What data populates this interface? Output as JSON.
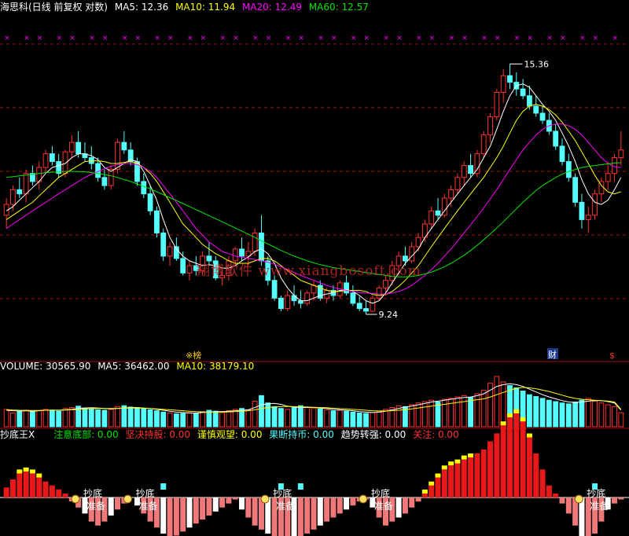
{
  "colors": {
    "up": "#ff3232",
    "down": "#54fcfc",
    "ma5": "#ffffff",
    "ma10": "#ffff00",
    "ma20": "#ff00ff",
    "ma60": "#00e600",
    "grid": "#a01010",
    "marker": "#ff00ff"
  },
  "main_header": {
    "title": "海思科(日线 前复权 对数)",
    "ma5_label": "MA5: 12.36",
    "ma10_label": "MA10: 11.94",
    "ma20_label": "MA20: 12.49",
    "ma60_label": "MA60: 12.57"
  },
  "volume_header": {
    "title": "VOLUME: 30565.90",
    "ma5_label": "MA5: 36462.00",
    "ma10_label": "MA10: 38179.10"
  },
  "indicator_header": {
    "title": "抄底王X",
    "items": [
      {
        "label": "注意底部: 0.00",
        "color": "#00e600"
      },
      {
        "label": "坚决持股: 0.00",
        "color": "#ff3232"
      },
      {
        "label": "谨慎观望: 0.00",
        "color": "#ffff00"
      },
      {
        "label": "果断持币: 0.00",
        "color": "#54fcfc"
      },
      {
        "label": "趋势转强: 0.00",
        "color": "#ffffff"
      },
      {
        "label": "关注: 0.00",
        "color": "#ff3232"
      }
    ]
  },
  "annotations": {
    "high": "15.36",
    "low": "9.24",
    "event_1": "※榜",
    "event_2": "财",
    "event_3": "$"
  },
  "indicator_labels": {
    "chao_di": "抄底",
    "zhun_bei": "准备"
  },
  "watermark": "翔博软件 www.xiangbosoft.com",
  "chart_data": {
    "type": "candlestick",
    "price_scale": "log",
    "ylim": [
      8.6,
      16.2
    ],
    "bars": [
      [
        11.3,
        11.7,
        11.0,
        11.55
      ],
      [
        11.55,
        12.0,
        11.4,
        11.9
      ],
      [
        11.9,
        12.2,
        11.7,
        11.8
      ],
      [
        11.8,
        12.4,
        11.6,
        12.3
      ],
      [
        12.3,
        12.5,
        12.0,
        12.1
      ],
      [
        12.1,
        12.6,
        11.9,
        12.45
      ],
      [
        12.45,
        12.9,
        12.3,
        12.8
      ],
      [
        12.8,
        13.0,
        12.5,
        12.6
      ],
      [
        12.6,
        12.8,
        12.2,
        12.3
      ],
      [
        12.3,
        12.9,
        12.2,
        12.85
      ],
      [
        12.85,
        13.3,
        12.7,
        13.1
      ],
      [
        13.1,
        13.4,
        12.7,
        12.8
      ],
      [
        12.8,
        13.1,
        12.6,
        12.7
      ],
      [
        12.7,
        13.0,
        12.4,
        12.55
      ],
      [
        12.55,
        12.7,
        12.1,
        12.2
      ],
      [
        12.2,
        12.4,
        11.9,
        12.0
      ],
      [
        12.0,
        12.5,
        11.9,
        12.4
      ],
      [
        12.4,
        13.2,
        12.3,
        13.1
      ],
      [
        13.1,
        13.4,
        12.8,
        12.9
      ],
      [
        12.9,
        13.1,
        12.5,
        12.6
      ],
      [
        12.6,
        12.7,
        12.0,
        12.1
      ],
      [
        12.1,
        12.3,
        11.7,
        11.8
      ],
      [
        11.8,
        12.0,
        11.3,
        11.4
      ],
      [
        11.4,
        11.5,
        10.8,
        10.9
      ],
      [
        10.9,
        11.0,
        10.3,
        10.4
      ],
      [
        10.4,
        10.7,
        10.2,
        10.6
      ],
      [
        10.6,
        10.8,
        10.3,
        10.35
      ],
      [
        10.35,
        10.5,
        10.0,
        10.05
      ],
      [
        10.05,
        10.3,
        9.9,
        10.2
      ],
      [
        10.2,
        10.4,
        10.0,
        10.1
      ],
      [
        10.1,
        10.5,
        10.0,
        10.4
      ],
      [
        10.4,
        10.7,
        10.2,
        10.3
      ],
      [
        10.3,
        10.4,
        9.9,
        9.95
      ],
      [
        9.95,
        10.1,
        9.8,
        10.0
      ],
      [
        10.0,
        10.4,
        9.9,
        10.3
      ],
      [
        10.3,
        10.6,
        10.2,
        10.55
      ],
      [
        10.55,
        10.8,
        10.3,
        10.4
      ],
      [
        10.4,
        10.7,
        10.2,
        10.5
      ],
      [
        10.5,
        11.0,
        10.4,
        10.9
      ],
      [
        10.9,
        11.3,
        10.2,
        10.3
      ],
      [
        10.3,
        10.4,
        9.8,
        9.9
      ],
      [
        9.9,
        10.0,
        9.5,
        9.55
      ],
      [
        9.55,
        9.6,
        9.3,
        9.35
      ],
      [
        9.35,
        9.7,
        9.3,
        9.6
      ],
      [
        9.6,
        9.8,
        9.4,
        9.5
      ],
      [
        9.5,
        9.7,
        9.35,
        9.45
      ],
      [
        9.45,
        9.7,
        9.4,
        9.65
      ],
      [
        9.65,
        9.9,
        9.5,
        9.8
      ],
      [
        9.8,
        9.9,
        9.5,
        9.55
      ],
      [
        9.55,
        9.75,
        9.45,
        9.7
      ],
      [
        9.7,
        9.8,
        9.5,
        9.6
      ],
      [
        9.6,
        9.9,
        9.55,
        9.85
      ],
      [
        9.85,
        10.0,
        9.6,
        9.65
      ],
      [
        9.65,
        9.8,
        9.4,
        9.45
      ],
      [
        9.45,
        9.6,
        9.3,
        9.35
      ],
      [
        9.35,
        9.5,
        9.24,
        9.3
      ],
      [
        9.3,
        9.6,
        9.28,
        9.55
      ],
      [
        9.55,
        9.8,
        9.5,
        9.75
      ],
      [
        9.75,
        10.0,
        9.6,
        9.9
      ],
      [
        9.9,
        10.3,
        9.8,
        10.2
      ],
      [
        10.2,
        10.5,
        10.0,
        10.4
      ],
      [
        10.4,
        10.6,
        10.2,
        10.3
      ],
      [
        10.3,
        10.7,
        10.25,
        10.6
      ],
      [
        10.6,
        10.9,
        10.5,
        10.8
      ],
      [
        10.8,
        11.2,
        10.7,
        11.1
      ],
      [
        11.1,
        11.5,
        11.0,
        11.4
      ],
      [
        11.4,
        11.7,
        11.2,
        11.3
      ],
      [
        11.3,
        11.8,
        11.25,
        11.7
      ],
      [
        11.7,
        12.0,
        11.5,
        11.9
      ],
      [
        11.9,
        12.3,
        11.8,
        12.2
      ],
      [
        12.2,
        12.6,
        12.0,
        12.5
      ],
      [
        12.5,
        12.8,
        12.2,
        12.3
      ],
      [
        12.3,
        12.9,
        12.2,
        12.8
      ],
      [
        12.8,
        13.4,
        12.7,
        13.3
      ],
      [
        13.3,
        13.9,
        13.1,
        13.8
      ],
      [
        13.8,
        14.6,
        13.7,
        14.5
      ],
      [
        14.5,
        15.2,
        14.2,
        15.0
      ],
      [
        15.0,
        15.36,
        14.6,
        14.8
      ],
      [
        14.8,
        15.1,
        14.4,
        14.6
      ],
      [
        14.6,
        14.9,
        14.3,
        14.4
      ],
      [
        14.4,
        14.7,
        14.0,
        14.1
      ],
      [
        14.1,
        14.4,
        13.8,
        13.9
      ],
      [
        13.9,
        14.1,
        13.6,
        13.7
      ],
      [
        13.7,
        13.9,
        13.3,
        13.4
      ],
      [
        13.4,
        13.6,
        12.9,
        13.0
      ],
      [
        13.0,
        13.2,
        12.5,
        12.6
      ],
      [
        12.6,
        12.8,
        12.1,
        12.2
      ],
      [
        12.2,
        12.3,
        11.5,
        11.6
      ],
      [
        11.6,
        11.8,
        11.0,
        11.2
      ],
      [
        11.2,
        11.5,
        10.9,
        11.3
      ],
      [
        11.3,
        11.9,
        11.2,
        11.8
      ],
      [
        11.8,
        12.2,
        11.6,
        12.1
      ],
      [
        12.1,
        12.6,
        11.9,
        12.3
      ],
      [
        12.3,
        12.8,
        12.1,
        12.7
      ],
      [
        12.7,
        13.4,
        12.5,
        12.9
      ]
    ],
    "ma5": [
      11.4,
      11.5,
      11.65,
      11.8,
      11.95,
      12.1,
      12.3,
      12.45,
      12.5,
      12.55,
      12.7,
      12.8,
      12.8,
      12.75,
      12.65,
      12.45,
      12.35,
      12.45,
      12.55,
      12.65,
      12.6,
      12.35,
      12.0,
      11.65,
      11.2,
      10.8,
      10.55,
      10.4,
      10.3,
      10.25,
      10.2,
      10.22,
      10.2,
      10.15,
      10.15,
      10.2,
      10.3,
      10.38,
      10.5,
      10.55,
      10.45,
      10.25,
      9.95,
      9.75,
      9.6,
      9.5,
      9.5,
      9.55,
      9.6,
      9.63,
      9.66,
      9.7,
      9.72,
      9.68,
      9.6,
      9.5,
      9.45,
      9.5,
      9.65,
      9.85,
      10.05,
      10.25,
      10.4,
      10.55,
      10.8,
      11.0,
      11.2,
      11.4,
      11.6,
      11.8,
      12.0,
      12.2,
      12.4,
      12.7,
      13.0,
      13.45,
      13.95,
      14.4,
      14.7,
      14.75,
      14.65,
      14.4,
      14.15,
      13.95,
      13.7,
      13.35,
      13.0,
      12.6,
      12.15,
      11.8,
      11.6,
      11.55,
      11.65,
      11.9,
      12.2
    ],
    "ma10": [
      11.2,
      11.3,
      11.4,
      11.5,
      11.6,
      11.75,
      11.9,
      12.05,
      12.2,
      12.3,
      12.4,
      12.5,
      12.6,
      12.62,
      12.62,
      12.6,
      12.55,
      12.55,
      12.58,
      12.6,
      12.55,
      12.45,
      12.3,
      12.1,
      11.85,
      11.6,
      11.35,
      11.1,
      10.95,
      10.8,
      10.65,
      10.55,
      10.45,
      10.38,
      10.3,
      10.25,
      10.25,
      10.25,
      10.3,
      10.35,
      10.35,
      10.3,
      10.2,
      10.1,
      10.0,
      9.9,
      9.85,
      9.8,
      9.75,
      9.7,
      9.68,
      9.68,
      9.7,
      9.7,
      9.7,
      9.68,
      9.62,
      9.6,
      9.62,
      9.68,
      9.78,
      9.9,
      10.05,
      10.2,
      10.4,
      10.6,
      10.8,
      11.0,
      11.2,
      11.4,
      11.6,
      11.8,
      12.0,
      12.2,
      12.45,
      12.7,
      13.0,
      13.35,
      13.7,
      13.95,
      14.1,
      14.15,
      14.1,
      14.0,
      13.85,
      13.65,
      13.4,
      13.15,
      12.85,
      12.55,
      12.25,
      12.0,
      11.85,
      11.8,
      11.85
    ],
    "ma20": [
      11.0,
      11.1,
      11.2,
      11.3,
      11.4,
      11.5,
      11.6,
      11.7,
      11.8,
      11.9,
      12.0,
      12.1,
      12.2,
      12.28,
      12.35,
      12.42,
      12.48,
      12.52,
      12.55,
      12.55,
      12.52,
      12.45,
      12.35,
      12.2,
      12.0,
      11.8,
      11.6,
      11.4,
      11.2,
      11.0,
      10.85,
      10.7,
      10.6,
      10.5,
      10.45,
      10.4,
      10.38,
      10.35,
      10.33,
      10.3,
      10.27,
      10.23,
      10.18,
      10.12,
      10.06,
      10.0,
      9.95,
      9.9,
      9.85,
      9.8,
      9.76,
      9.73,
      9.7,
      9.68,
      9.66,
      9.65,
      9.64,
      9.63,
      9.63,
      9.65,
      9.68,
      9.73,
      9.8,
      9.9,
      10.0,
      10.12,
      10.25,
      10.4,
      10.55,
      10.72,
      10.9,
      11.08,
      11.27,
      11.47,
      11.68,
      11.9,
      12.15,
      12.4,
      12.65,
      12.9,
      13.1,
      13.3,
      13.45,
      13.55,
      13.6,
      13.6,
      13.55,
      13.45,
      13.3,
      13.1,
      12.9,
      12.7,
      12.55,
      12.47,
      12.45
    ],
    "ma60": [
      12.2,
      12.22,
      12.24,
      12.26,
      12.28,
      12.3,
      12.32,
      12.33,
      12.34,
      12.35,
      12.35,
      12.35,
      12.34,
      12.32,
      12.3,
      12.27,
      12.24,
      12.2,
      12.15,
      12.1,
      12.04,
      11.98,
      11.92,
      11.85,
      11.78,
      11.71,
      11.64,
      11.57,
      11.5,
      11.43,
      11.36,
      11.29,
      11.22,
      11.15,
      11.08,
      11.01,
      10.94,
      10.87,
      10.8,
      10.73,
      10.66,
      10.59,
      10.52,
      10.46,
      10.4,
      10.35,
      10.3,
      10.26,
      10.22,
      10.19,
      10.16,
      10.14,
      10.12,
      10.1,
      10.08,
      10.06,
      10.04,
      10.02,
      10.0,
      9.98,
      9.97,
      9.97,
      9.98,
      10.0,
      10.03,
      10.07,
      10.12,
      10.18,
      10.25,
      10.33,
      10.42,
      10.52,
      10.63,
      10.75,
      10.88,
      11.01,
      11.15,
      11.3,
      11.45,
      11.6,
      11.74,
      11.88,
      12.0,
      12.1,
      12.2,
      12.28,
      12.35,
      12.4,
      12.45,
      12.48,
      12.5,
      12.52,
      12.54,
      12.56,
      12.57
    ],
    "volume": [
      38000,
      30000,
      34000,
      36000,
      33000,
      35000,
      38000,
      36000,
      34000,
      40000,
      42000,
      45000,
      41000,
      39000,
      37000,
      36000,
      38000,
      44000,
      46000,
      43000,
      41000,
      40000,
      37000,
      35000,
      32000,
      30000,
      28000,
      29000,
      31000,
      30000,
      33000,
      36000,
      34000,
      31000,
      35000,
      38000,
      40000,
      37000,
      56000,
      68000,
      52000,
      44000,
      40000,
      38000,
      42000,
      46000,
      43000,
      41000,
      39000,
      37000,
      35000,
      36000,
      34000,
      32000,
      30000,
      29000,
      31000,
      34000,
      38000,
      42000,
      46000,
      44000,
      48000,
      52000,
      55000,
      58000,
      54000,
      60000,
      62000,
      65000,
      68000,
      64000,
      72000,
      80000,
      95000,
      110000,
      98000,
      90000,
      85000,
      78000,
      70000,
      66000,
      62000,
      58000,
      55000,
      52000,
      50000,
      54000,
      58000,
      62000,
      56000,
      52000,
      48000,
      44000,
      30566
    ],
    "vol_ma5": [
      36000,
      35000,
      34500,
      35000,
      34000,
      35000,
      36000,
      36500,
      36000,
      37000,
      38000,
      40000,
      41000,
      41500,
      41000,
      40000,
      39000,
      40000,
      41000,
      42000,
      42000,
      41000,
      40000,
      38000,
      36000,
      34000,
      32000,
      31000,
      30000,
      30000,
      31000,
      32000,
      33000,
      33000,
      34000,
      35000,
      36000,
      37000,
      42000,
      48000,
      50000,
      51000,
      49000,
      45000,
      43000,
      42000,
      42000,
      42000,
      41000,
      40000,
      38000,
      37000,
      36000,
      35000,
      33000,
      32000,
      31000,
      32000,
      34000,
      37000,
      40000,
      43000,
      45000,
      48000,
      51000,
      54000,
      56000,
      58000,
      60000,
      62000,
      64000,
      65000,
      68000,
      72000,
      80000,
      88000,
      92000,
      94000,
      92000,
      88000,
      82000,
      76000,
      70000,
      65000,
      61000,
      57000,
      54000,
      53000,
      54000,
      56000,
      57000,
      57000,
      55000,
      52000,
      36462
    ],
    "vol_ma10": [
      37000,
      36500,
      36000,
      35800,
      35500,
      35600,
      36000,
      36200,
      36200,
      36500,
      37000,
      38000,
      39000,
      39500,
      39800,
      40000,
      40000,
      40200,
      40500,
      41000,
      41000,
      40500,
      40000,
      39000,
      38000,
      37000,
      36000,
      35000,
      34000,
      33000,
      32500,
      32000,
      32000,
      32000,
      32500,
      33000,
      34000,
      35000,
      37000,
      40000,
      42000,
      43000,
      44000,
      44500,
      44000,
      43500,
      43000,
      42500,
      42000,
      41500,
      40500,
      39500,
      39000,
      38000,
      37000,
      36000,
      35000,
      34500,
      34500,
      35000,
      36000,
      37500,
      39000,
      41000,
      43000,
      45000,
      47000,
      49000,
      51000,
      53000,
      55000,
      57000,
      59000,
      61000,
      65000,
      70000,
      75000,
      80000,
      84000,
      86000,
      85000,
      83000,
      80000,
      77000,
      73000,
      69000,
      65000,
      62000,
      60000,
      59000,
      58000,
      57000,
      56000,
      54000,
      38179
    ],
    "indicator": [
      5,
      9,
      12,
      13,
      12,
      10,
      8,
      6,
      4,
      2,
      -2,
      -5,
      -8,
      -12,
      -14,
      -12,
      -9,
      -6,
      -3,
      0,
      -4,
      -8,
      -12,
      -15,
      -18,
      -20,
      -19,
      -17,
      -15,
      -13,
      -11,
      -9,
      -7,
      -5,
      -3,
      -1,
      -6,
      -10,
      -14,
      -16,
      -18,
      -20,
      -22,
      -24,
      -22,
      -20,
      -18,
      -16,
      -14,
      -12,
      -10,
      -8,
      -6,
      -4,
      -2,
      -1,
      -5,
      -10,
      -14,
      -12,
      -10,
      -8,
      -5,
      -2,
      2,
      6,
      10,
      14,
      16,
      17,
      19,
      20,
      22,
      24,
      28,
      32,
      36,
      40,
      42,
      38,
      30,
      22,
      14,
      6,
      2,
      -3,
      -8,
      -14,
      -20,
      -25,
      -18,
      -12,
      -6,
      -3,
      -1
    ],
    "indicator_highlights": [
      2,
      3,
      4,
      5,
      64,
      65,
      66,
      67,
      68,
      69,
      70,
      71,
      76,
      77,
      78,
      79,
      80
    ]
  }
}
